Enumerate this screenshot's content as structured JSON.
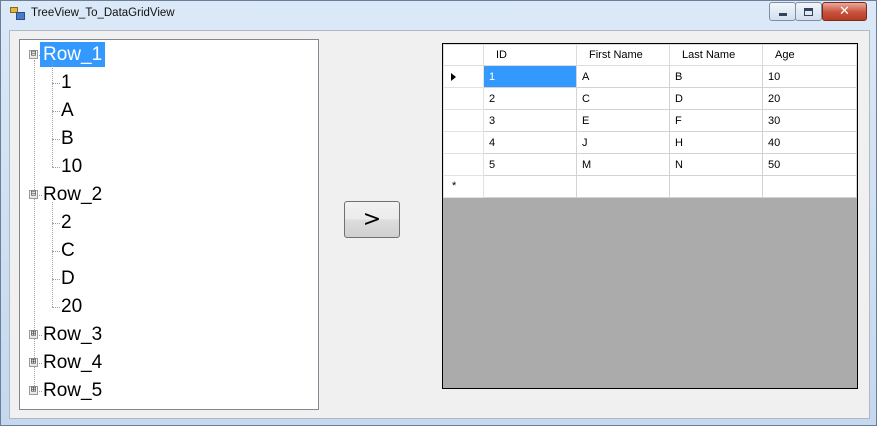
{
  "window": {
    "title": "TreeView_To_DataGridView",
    "app_icon": "form-icon",
    "controls": {
      "minimize": "minimize-icon",
      "maximize": "maximize-icon",
      "close": "close-icon",
      "close_glyph": "✕"
    },
    "colors": {
      "frame": "#c9dcf0",
      "client": "#f0f0f0",
      "selection": "#3399ff",
      "grid_empty_area": "#ababab"
    }
  },
  "tree": {
    "nodes": [
      {
        "label": "Row_1",
        "expanded": true,
        "selected": true,
        "toggle": "⊟",
        "children": [
          "1",
          "A",
          "B",
          "10"
        ]
      },
      {
        "label": "Row_2",
        "expanded": true,
        "selected": false,
        "toggle": "⊟",
        "children": [
          "2",
          "C",
          "D",
          "20"
        ]
      },
      {
        "label": "Row_3",
        "expanded": false,
        "selected": false,
        "toggle": "⊞",
        "children": []
      },
      {
        "label": "Row_4",
        "expanded": false,
        "selected": false,
        "toggle": "⊞",
        "children": []
      },
      {
        "label": "Row_5",
        "expanded": false,
        "selected": false,
        "toggle": "⊞",
        "children": []
      }
    ]
  },
  "move_button": {
    "label": ">"
  },
  "grid": {
    "columns": [
      "ID",
      "First Name",
      "Last Name",
      "Age"
    ],
    "rows": [
      [
        "1",
        "A",
        "B",
        "10"
      ],
      [
        "2",
        "C",
        "D",
        "20"
      ],
      [
        "3",
        "E",
        "F",
        "30"
      ],
      [
        "4",
        "J",
        "H",
        "40"
      ],
      [
        "5",
        "M",
        "N",
        "50"
      ]
    ],
    "current_row_marker": "row-pointer-icon",
    "new_row_marker": "*",
    "selected_cell": {
      "row": 0,
      "column": 0
    }
  }
}
